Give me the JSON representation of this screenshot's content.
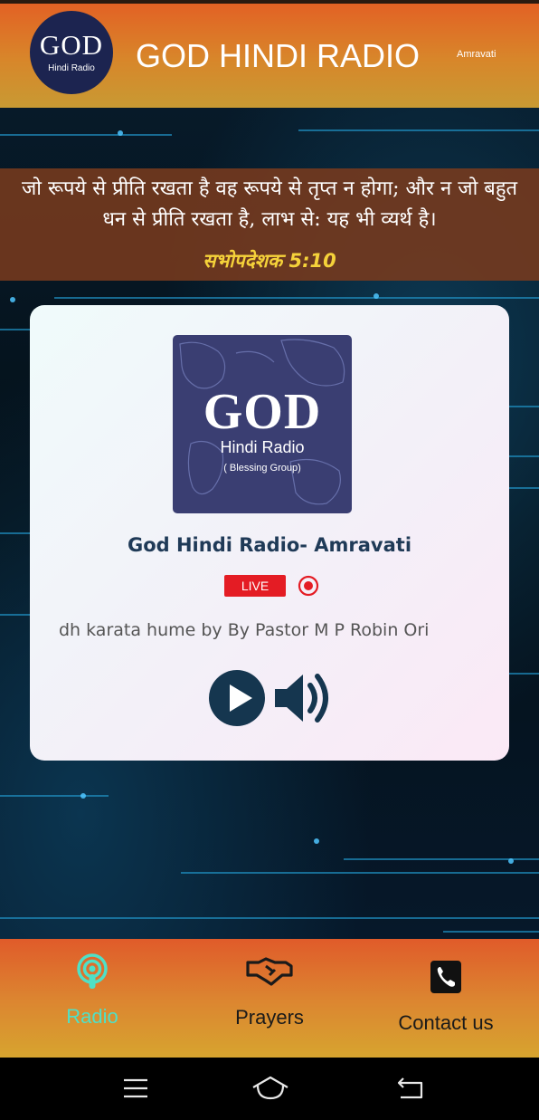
{
  "header": {
    "logo": {
      "big": "GOD",
      "small": "Hindi Radio"
    },
    "title": "GOD HINDI RADIO",
    "location": "Amravati"
  },
  "verse": {
    "text": "जो रूपये से प्रीति रखता है वह रूपये से तृप्त न होगा; और न जो बहुत धन से प्रीति रखता है, लाभ से: यह भी व्यर्थ है।",
    "reference": "सभोपदेशक 5:10"
  },
  "player": {
    "artwork": {
      "title": "GOD",
      "subtitle": "Hindi Radio",
      "tagline": "( Blessing Group)"
    },
    "station_name": "God Hindi Radio- Amravati",
    "live_badge": "LIVE",
    "now_playing": "dh karata hume by By Pastor M P Robin Ori",
    "play_icon": "play-circle-icon",
    "volume_icon": "speaker-volume-icon",
    "accent_color": "#15364f",
    "live_color": "#e41c24"
  },
  "bottom_nav": {
    "items": [
      {
        "label": "Radio",
        "icon": "podcast-radio-icon",
        "active": true,
        "color": "#4fe0c6"
      },
      {
        "label": "Prayers",
        "icon": "handshake-icon",
        "active": false,
        "color": "#1a1a1a"
      },
      {
        "label": "Contact us",
        "icon": "phone-icon",
        "active": false,
        "color": "#1a1a1a"
      }
    ]
  },
  "system_nav": {
    "menu_icon": "menu-icon",
    "home_icon": "home-icon",
    "back_icon": "back-icon"
  }
}
